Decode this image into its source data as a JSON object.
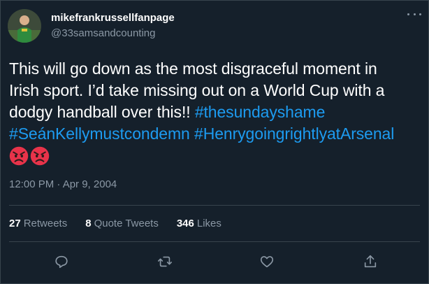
{
  "author": {
    "display_name": "mikefrankrussellfanpage",
    "handle": "@33samsandcounting",
    "avatar_icon": "player-avatar"
  },
  "tweet": {
    "text_line_1": "This will go down as the most disgraceful moment in",
    "text_line_2": "Irish sport. I’d take missing out on a World Cup with a",
    "text_line_3": "dodgy handball over this!! ",
    "hashtag_1": "#thesundayshame",
    "hashtag_2": "#SeánKellymustcondemn",
    "hashtag_3": "#HenrygoingrightlyatArsenal",
    "emojis": [
      "angry-face",
      "angry-face"
    ],
    "timestamp": "12:00 PM · Apr 9, 2004"
  },
  "stats": {
    "retweets_count": "27",
    "retweets_label": "Retweets",
    "quotes_count": "8",
    "quotes_label": "Quote Tweets",
    "likes_count": "346",
    "likes_label": "Likes"
  },
  "colors": {
    "background": "#15202b",
    "hashtag": "#1d9bf0",
    "secondary_text": "#8b98a5",
    "divider": "#38444d",
    "emoji": "#f4245e"
  },
  "actions": [
    "reply-icon",
    "retweet-icon",
    "like-icon",
    "share-icon"
  ]
}
